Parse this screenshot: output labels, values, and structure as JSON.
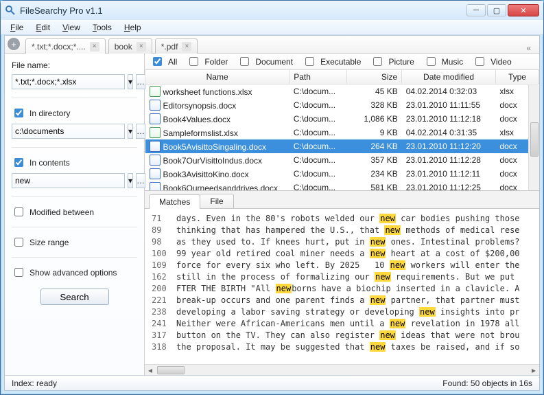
{
  "window": {
    "title": "FileSearchy Pro v1.1"
  },
  "menu": [
    "File",
    "Edit",
    "View",
    "Tools",
    "Help"
  ],
  "search_tabs": [
    {
      "label": "*.txt;*.docx;*....",
      "active": true
    },
    {
      "label": "book",
      "active": false
    },
    {
      "label": "*.pdf",
      "active": false
    }
  ],
  "sidebar": {
    "filename_label": "File name:",
    "filename_value": "*.txt;*.docx;*.xlsx",
    "indir_label": "In directory",
    "directory_value": "c:\\documents",
    "incontents_label": "In contents",
    "contents_value": "new",
    "modified_label": "Modified between",
    "sizerange_label": "Size range",
    "advanced_label": "Show advanced options",
    "search_button": "Search"
  },
  "filters": [
    {
      "label": "All",
      "checked": true
    },
    {
      "label": "Folder",
      "checked": false
    },
    {
      "label": "Document",
      "checked": false
    },
    {
      "label": "Executable",
      "checked": false
    },
    {
      "label": "Picture",
      "checked": false
    },
    {
      "label": "Music",
      "checked": false
    },
    {
      "label": "Video",
      "checked": false
    }
  ],
  "columns": [
    "Name",
    "Path",
    "Size",
    "Date modified",
    "Type"
  ],
  "rows": [
    {
      "name": "worksheet functions.xlsx",
      "path": "C:\\docum...",
      "size": "45 KB",
      "date": "04.02.2014 0:32:03",
      "type": "xlsx",
      "icon": "xlsx",
      "selected": false
    },
    {
      "name": "Editorsynopsis.docx",
      "path": "C:\\docum...",
      "size": "328 KB",
      "date": "23.01.2010 11:11:55",
      "type": "docx",
      "icon": "docx",
      "selected": false
    },
    {
      "name": "Book4Values.docx",
      "path": "C:\\docum...",
      "size": "1,086 KB",
      "date": "23.01.2010 11:12:18",
      "type": "docx",
      "icon": "docx",
      "selected": false
    },
    {
      "name": "Sampleformslist.xlsx",
      "path": "C:\\docum...",
      "size": "9 KB",
      "date": "04.02.2014 0:31:35",
      "type": "xlsx",
      "icon": "xlsx",
      "selected": false
    },
    {
      "name": "Book5AvisittoSingaling.docx",
      "path": "C:\\docum...",
      "size": "264 KB",
      "date": "23.01.2010 11:12:20",
      "type": "docx",
      "icon": "docx",
      "selected": true
    },
    {
      "name": "Book7OurVisittoIndus.docx",
      "path": "C:\\docum...",
      "size": "357 KB",
      "date": "23.01.2010 11:12:28",
      "type": "docx",
      "icon": "docx",
      "selected": false
    },
    {
      "name": "Book3AvisittoKino.docx",
      "path": "C:\\docum...",
      "size": "234 KB",
      "date": "23.01.2010 11:12:11",
      "type": "docx",
      "icon": "docx",
      "selected": false
    },
    {
      "name": "Book6Ourneedsanddrives.docx",
      "path": "C:\\docum...",
      "size": "581 KB",
      "date": "23.01.2010 11:12:25",
      "type": "docx",
      "icon": "docx",
      "selected": false
    }
  ],
  "preview": {
    "tabs": [
      "Matches",
      "File"
    ],
    "highlight": "new",
    "lines": [
      {
        "n": 71,
        "t": "days. Even in the 80's robots welded our new car bodies pushing those"
      },
      {
        "n": 89,
        "t": "thinking that has hampered the U.S., that new methods of medical rese"
      },
      {
        "n": 98,
        "t": "as they used to. If knees hurt, put in new ones. Intestinal problems?"
      },
      {
        "n": 100,
        "t": "99 year old retired coal miner needs a new heart at a cost of $200,00"
      },
      {
        "n": 109,
        "t": "force for every six who left. By 2025   10 new workers will enter the"
      },
      {
        "n": 162,
        "t": "still in the process of formalizing our new requirements. But we put "
      },
      {
        "n": 200,
        "t": "FTER THE BIRTH \"All newborns have a biochip inserted in a clavicle. A"
      },
      {
        "n": 221,
        "t": "break-up occurs and one parent finds a new partner, that partner must"
      },
      {
        "n": 238,
        "t": "developing a labor saving strategy or developing new insights into pr"
      },
      {
        "n": 241,
        "t": "Neither were African-Americans men until a new revelation in 1978 all"
      },
      {
        "n": 317,
        "t": "button on the TV. They can also register new ideas that were not brou"
      },
      {
        "n": 318,
        "t": "the proposal. It may be suggested that new taxes be raised, and if so"
      }
    ]
  },
  "status": {
    "left": "Index: ready",
    "right": "Found: 50 objects in 16s"
  }
}
